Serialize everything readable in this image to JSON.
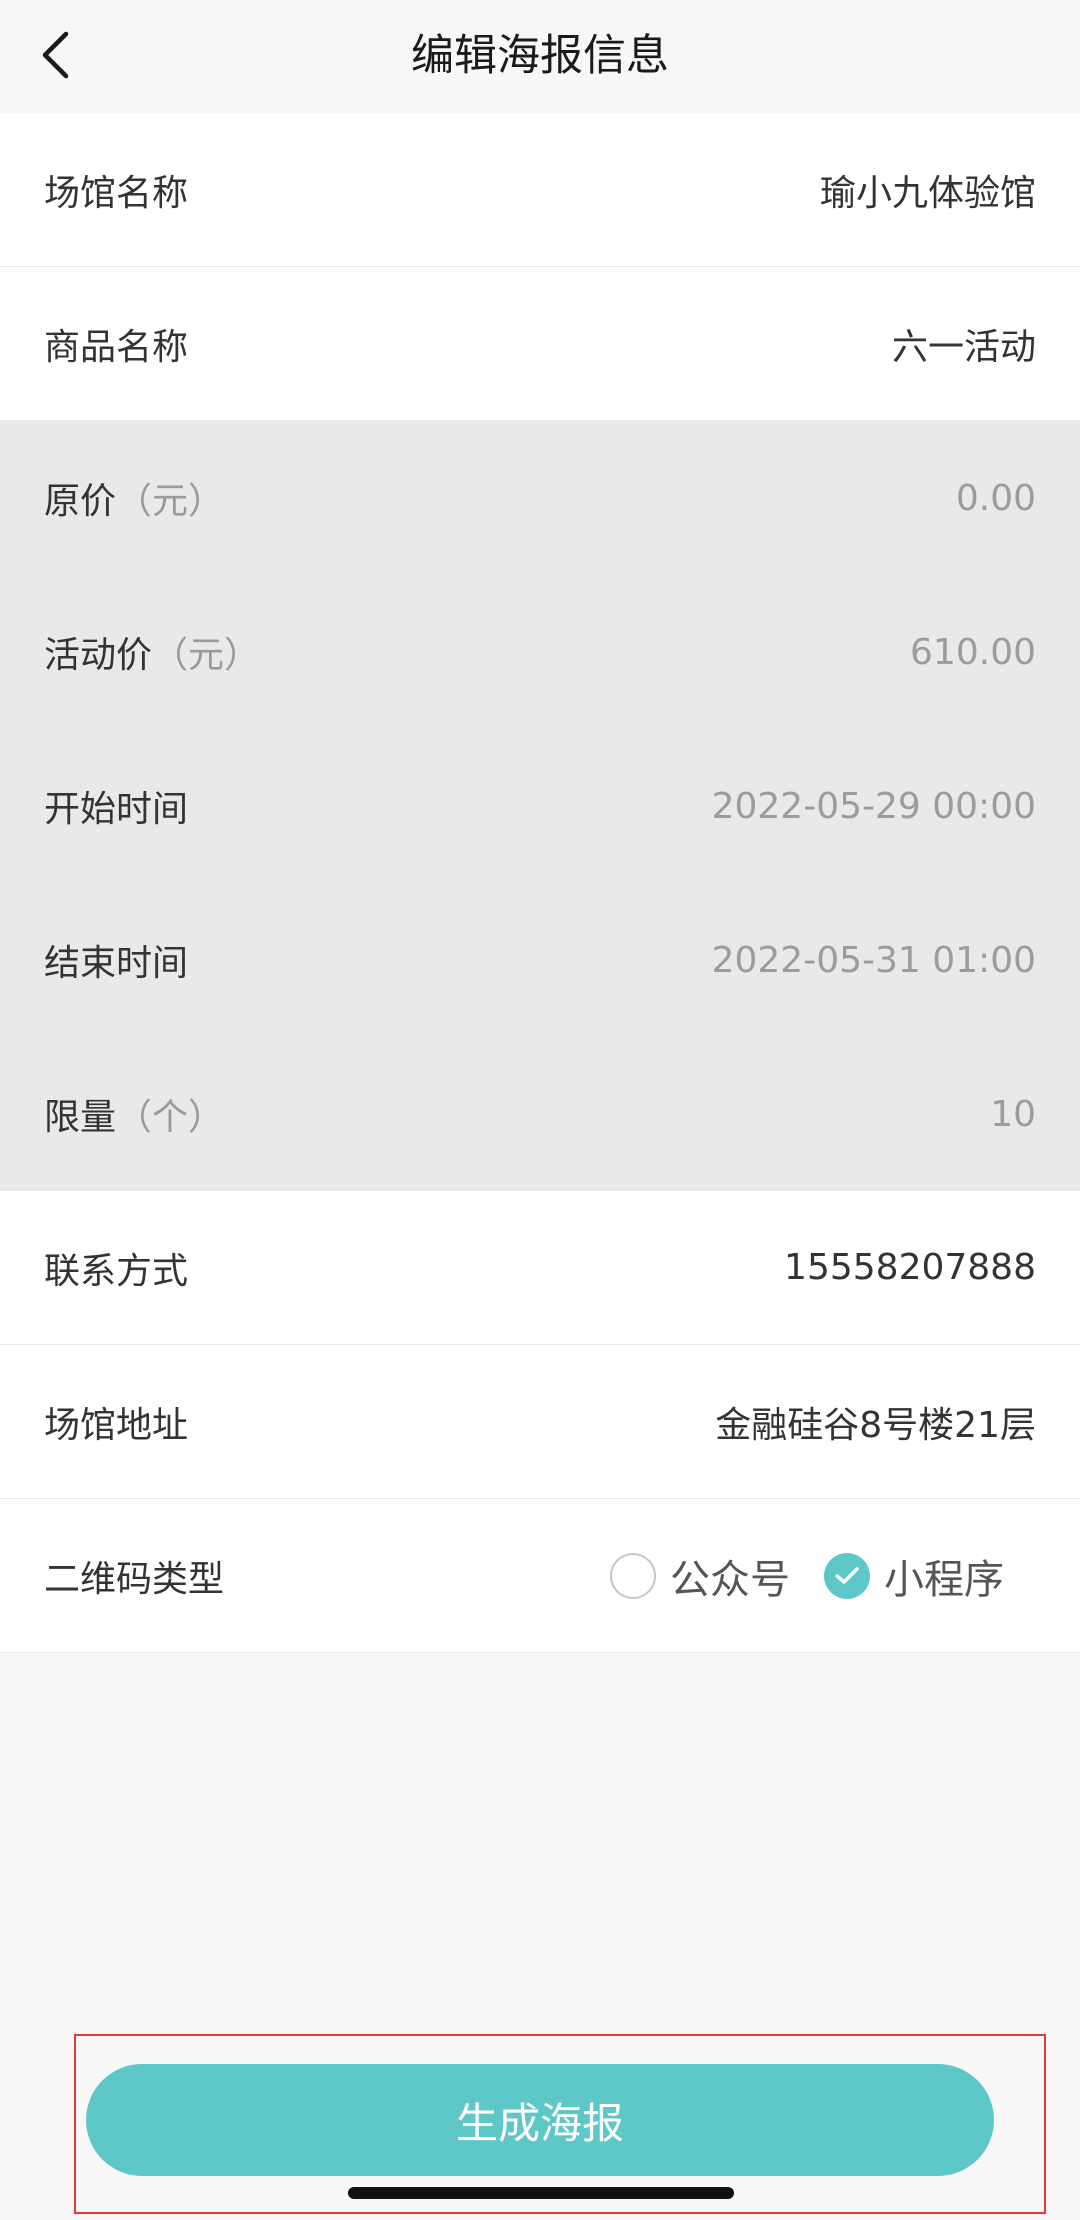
{
  "header": {
    "title": "编辑海报信息",
    "back_icon": "chevron-left-icon"
  },
  "rows": [
    {
      "label": "场馆名称",
      "unit": "",
      "value": "瑜小九体验馆"
    },
    {
      "label": "商品名称",
      "unit": "",
      "value": "六一活动"
    },
    {
      "label": "原价",
      "unit": "（元）",
      "value": "0.00"
    },
    {
      "label": "活动价",
      "unit": "（元）",
      "value": "610.00"
    },
    {
      "label": "开始时间",
      "unit": "",
      "value": "2022-05-29 00:00"
    },
    {
      "label": "结束时间",
      "unit": "",
      "value": "2022-05-31 01:00"
    },
    {
      "label": "限量",
      "unit": "（个）",
      "value": "10"
    },
    {
      "label": "联系方式",
      "unit": "",
      "value": "15558207888"
    },
    {
      "label": "场馆地址",
      "unit": "",
      "value": "金融硅谷8号楼21层"
    }
  ],
  "qr_type": {
    "label": "二维码类型",
    "options": [
      {
        "label": "公众号",
        "checked": false
      },
      {
        "label": "小程序",
        "checked": true
      }
    ]
  },
  "footer": {
    "generate_label": "生成海报"
  },
  "colors": {
    "accent": "#5ec8c8",
    "disabled_row": "#e9e9e9",
    "highlight_border": "#e23b3b"
  }
}
